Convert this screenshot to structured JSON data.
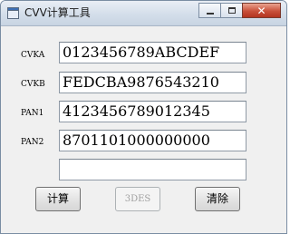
{
  "window": {
    "title": "CVV计算工具",
    "close_glyph": "✕"
  },
  "fields": [
    {
      "label": "CVKA",
      "value": "0123456789ABCDEF"
    },
    {
      "label": "CVKB",
      "value": "FEDCBA9876543210"
    },
    {
      "label": "PAN1",
      "value": "4123456789012345"
    },
    {
      "label": "PAN2",
      "value": "8701101000000000"
    }
  ],
  "result": {
    "value": ""
  },
  "buttons": {
    "calc": "计算",
    "des3": "3DES",
    "clear": "清除"
  }
}
